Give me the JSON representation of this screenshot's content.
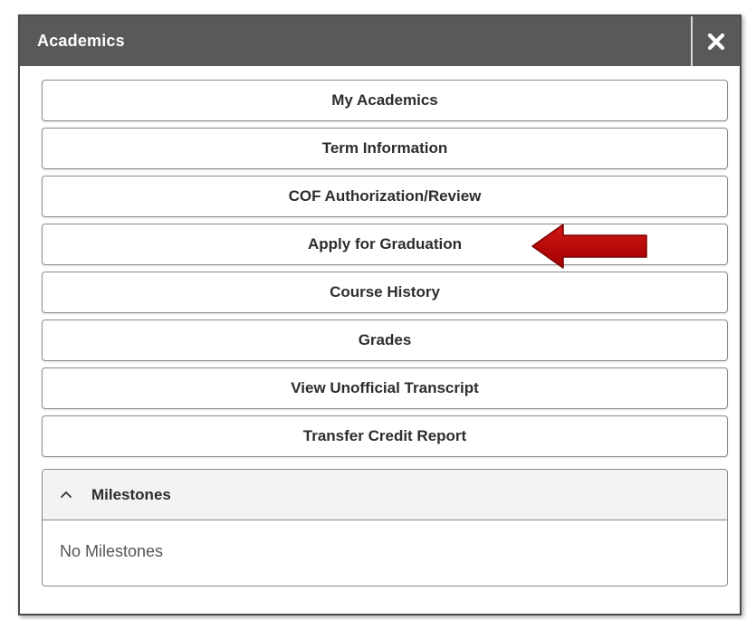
{
  "panel": {
    "title": "Academics",
    "close_icon": "close-icon"
  },
  "menu": {
    "items": [
      {
        "label": "My Academics"
      },
      {
        "label": "Term Information"
      },
      {
        "label": "COF Authorization/Review"
      },
      {
        "label": "Apply for Graduation"
      },
      {
        "label": "Course History"
      },
      {
        "label": "Grades"
      },
      {
        "label": "View Unofficial Transcript"
      },
      {
        "label": "Transfer Credit Report"
      }
    ]
  },
  "milestones": {
    "title": "Milestones",
    "chevron_icon": "chevron-up-icon",
    "empty_text": "No Milestones"
  },
  "annotation": {
    "arrow_icon": "left-arrow-icon",
    "arrow_color": "#c00000",
    "arrow_target": "Apply for Graduation"
  },
  "colors": {
    "header_bg": "#595959",
    "header_text": "#ffffff",
    "button_border": "#8a8a8a",
    "milestones_header_bg": "#f3f3f3"
  }
}
